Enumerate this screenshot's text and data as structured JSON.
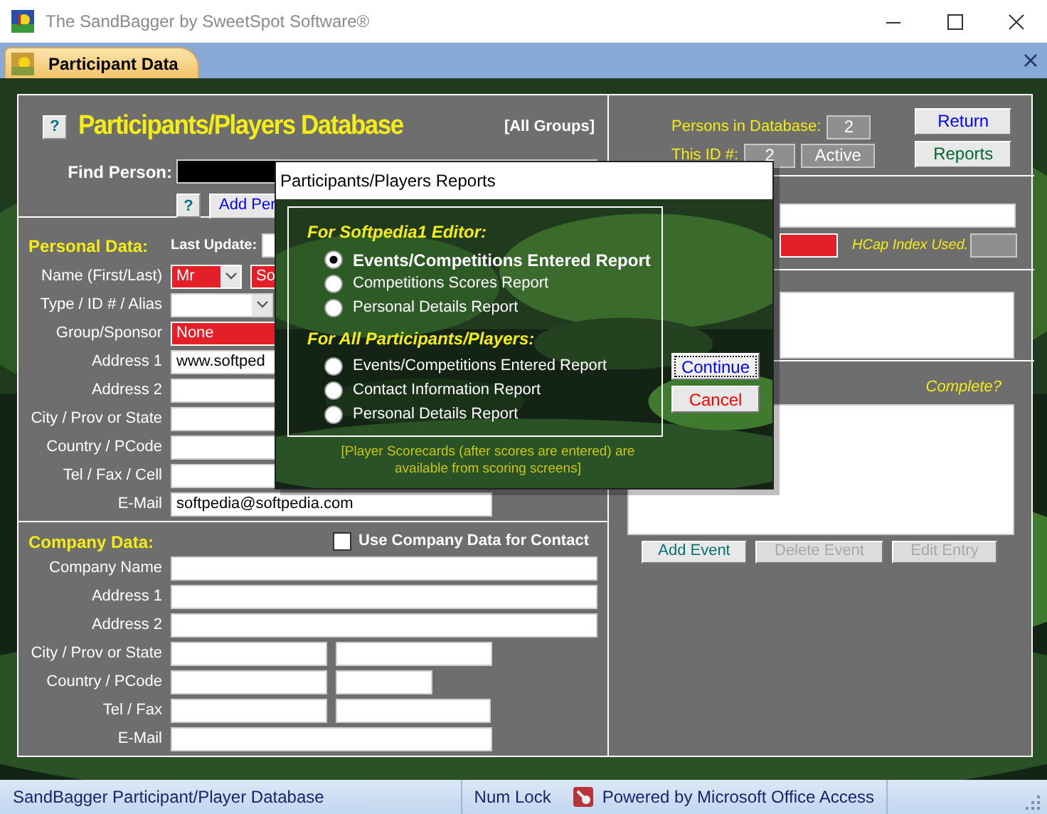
{
  "window": {
    "title": "The SandBagger by SweetSpot Software®"
  },
  "document_tab": {
    "label": "Participant Data"
  },
  "form": {
    "header": {
      "help": "?",
      "title": "Participants/Players Database",
      "scope": "[All Groups]",
      "find_label": "Find Person:",
      "add_help": "?",
      "add_button": "Add Per"
    },
    "personal": {
      "heading": "Personal Data:",
      "last_update_label": "Last Update:",
      "rows": [
        {
          "label": "Name (First/Last)",
          "fields": [
            {
              "kind": "dropdown",
              "value": "Mr",
              "required": true
            },
            {
              "kind": "text",
              "value": "So",
              "required": true
            }
          ]
        },
        {
          "label": "Type / ID # / Alias",
          "fields": [
            {
              "kind": "dropdown",
              "required": false
            }
          ]
        },
        {
          "label": "Group/Sponsor",
          "fields": [
            {
              "kind": "text",
              "value": "None",
              "required": true
            }
          ]
        },
        {
          "label": "Address 1",
          "fields": [
            {
              "kind": "text",
              "value": "www.softped",
              "required": false
            }
          ]
        },
        {
          "label": "Address 2",
          "fields": [
            {
              "kind": "text",
              "required": false
            }
          ]
        },
        {
          "label": "City / Prov or State",
          "fields": [
            {
              "kind": "text",
              "required": false
            }
          ]
        },
        {
          "label": "Country / PCode",
          "fields": [
            {
              "kind": "text",
              "required": false
            }
          ]
        },
        {
          "label": "Tel / Fax / Cell",
          "fields": [
            {
              "kind": "text",
              "required": false
            }
          ]
        },
        {
          "label": "E-Mail",
          "fields": [
            {
              "kind": "text",
              "value": "softpedia@softpedia.com",
              "required": false
            }
          ]
        }
      ]
    },
    "company": {
      "heading": "Company Data:",
      "use_company": {
        "label": "Use Company Data for Contact",
        "checked": false
      },
      "rows": [
        {
          "label": "Company Name",
          "fields": [
            {
              "kind": "text",
              "required": false
            }
          ]
        },
        {
          "label": "Address 1",
          "fields": [
            {
              "kind": "text",
              "required": false
            }
          ]
        },
        {
          "label": "Address 2",
          "fields": [
            {
              "kind": "text",
              "required": false
            }
          ]
        },
        {
          "label": "City / Prov or State",
          "fields": [
            {
              "kind": "text",
              "required": false
            },
            {
              "kind": "text",
              "required": false
            }
          ]
        },
        {
          "label": "Country / PCode",
          "fields": [
            {
              "kind": "text",
              "required": false
            },
            {
              "kind": "text",
              "required": false
            }
          ]
        },
        {
          "label": "Tel / Fax",
          "fields": [
            {
              "kind": "text",
              "required": false
            },
            {
              "kind": "text",
              "required": false
            }
          ]
        },
        {
          "label": "E-Mail",
          "fields": [
            {
              "kind": "text",
              "required": false
            }
          ]
        }
      ]
    },
    "summary": {
      "persons_label": "Persons in Database:",
      "persons_value": "2",
      "id_label": "This ID #:",
      "id_value": "2",
      "status": "Active",
      "buttons": [
        {
          "label": "Return",
          "color": "#0000ff"
        },
        {
          "label": "Reports",
          "color": "#006633"
        }
      ]
    },
    "handicap": {
      "hcap_label": "HCap Index Used."
    },
    "events": {
      "complete_label": "Complete?",
      "buttons": [
        {
          "label": "Add Event",
          "disabled": false
        },
        {
          "label": "Delete Event",
          "disabled": true
        },
        {
          "label": "Edit Entry",
          "disabled": true
        }
      ]
    }
  },
  "dialog": {
    "title": "Participants/Players Reports",
    "groups": [
      {
        "heading": "For Softpedia1 Editor:",
        "options": [
          {
            "label": "Events/Competitions Entered Report",
            "selected": true
          },
          {
            "label": "Competitions Scores Report",
            "selected": false
          },
          {
            "label": "Personal Details Report",
            "selected": false
          }
        ]
      },
      {
        "heading": "For All Participants/Players:",
        "options": [
          {
            "label": "Events/Competitions Entered Report",
            "selected": false
          },
          {
            "label": "Contact Information Report",
            "selected": false
          },
          {
            "label": "Personal Details Report",
            "selected": false
          }
        ]
      }
    ],
    "note": "[Player Scorecards (after scores are entered) are available from scoring screens]",
    "buttons": [
      {
        "label": "Continue",
        "color": "#0000ff",
        "focused": true
      },
      {
        "label": "Cancel",
        "color": "#ff0000",
        "focused": false
      }
    ]
  },
  "status_bar": {
    "message": "SandBagger Participant/Player Database",
    "num_lock": "Num Lock",
    "powered_by": "Powered by Microsoft Office Access"
  }
}
